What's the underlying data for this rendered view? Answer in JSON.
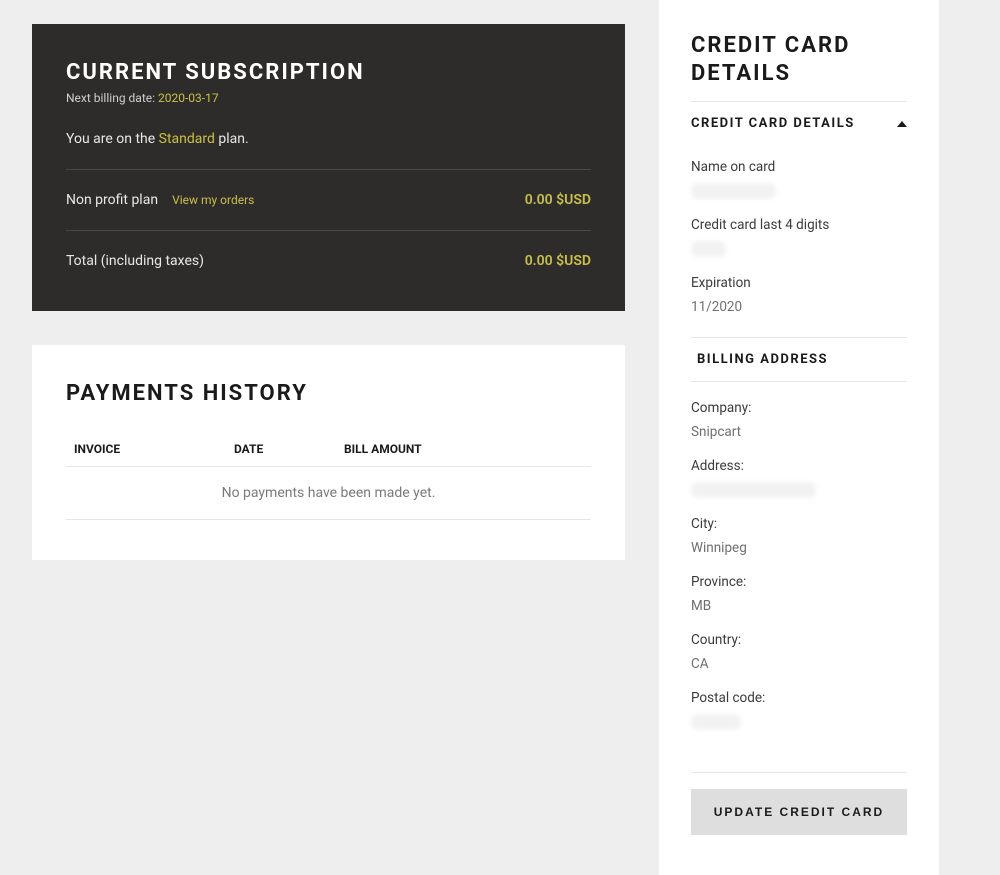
{
  "subscription": {
    "title": "CURRENT SUBSCRIPTION",
    "next_billing_label": "Next billing date: ",
    "next_billing_date": "2020-03-17",
    "plan_prefix": "You are on the ",
    "plan_name": "Standard",
    "plan_suffix": " plan.",
    "row1_label": "Non profit plan",
    "row1_link": "View my orders",
    "row1_amount": "0.00 $USD",
    "row2_label": "Total (including taxes)",
    "row2_amount": "0.00 $USD"
  },
  "payments": {
    "title": "PAYMENTS HISTORY",
    "col_invoice": "INVOICE",
    "col_date": "DATE",
    "col_amount": "BILL AMOUNT",
    "empty_message": "No payments have been made yet."
  },
  "credit_card": {
    "title_line1": "CREDIT CARD",
    "title_line2": "DETAILS",
    "section_header": "CREDIT CARD DETAILS",
    "name_label": "Name on card",
    "last4_label": "Credit card last 4 digits",
    "exp_label": "Expiration",
    "exp_value": "11/2020",
    "billing_header": "BILLING ADDRESS",
    "company_label": "Company:",
    "company_value": "Snipcart",
    "address_label": "Address:",
    "city_label": "City:",
    "city_value": "Winnipeg",
    "province_label": "Province:",
    "province_value": "MB",
    "country_label": "Country:",
    "country_value": "CA",
    "postal_label": "Postal code:",
    "update_button": "UPDATE CREDIT CARD"
  }
}
